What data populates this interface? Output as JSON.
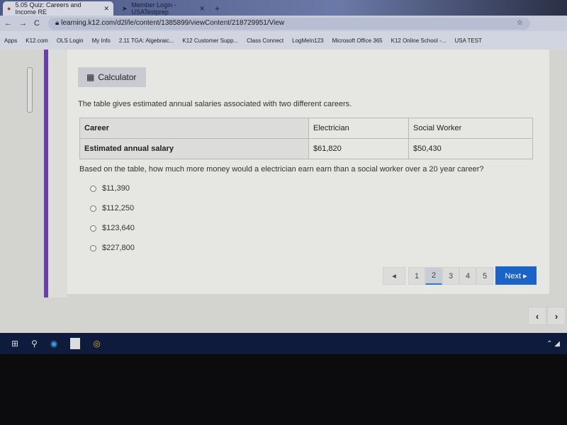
{
  "browser": {
    "tabs": [
      {
        "label": "5.05 Quiz: Careers and Income RE",
        "active": true
      },
      {
        "label": "Member Login - USATestprep",
        "active": false
      }
    ],
    "new_tab": "+",
    "url": "learning.k12.com/d2l/le/content/1385899/viewContent/218729951/View",
    "bookmarks": [
      "Apps",
      "K12.com",
      "OLS Login",
      "My Info",
      "2.11 TGA: Algebraic...",
      "K12 Customer Supp...",
      "Class Connect",
      "LogMeIn123",
      "Microsoft Office 365",
      "K12 Online School -...",
      "USA TEST"
    ]
  },
  "quiz": {
    "calculator_label": "Calculator",
    "intro": "The table gives estimated annual salaries associated with two different careers.",
    "table": {
      "headers": [
        "Career",
        "Electrician",
        "Social Worker"
      ],
      "rows": [
        [
          "Estimated annual salary",
          "$61,820",
          "$50,430"
        ]
      ]
    },
    "question": "Based on the table, how much more money would a electrician earn earn than a social worker over a 20 year career?",
    "options": [
      "$11,390",
      "$112,250",
      "$123,640",
      "$227,800"
    ],
    "pages": [
      "1",
      "2",
      "3",
      "4",
      "5"
    ],
    "current_page": 2,
    "next_label": "Next ▸",
    "prev_label": "◂"
  },
  "colors": {
    "accent": "#1b63c6",
    "stripe": "#6b3fa8"
  }
}
